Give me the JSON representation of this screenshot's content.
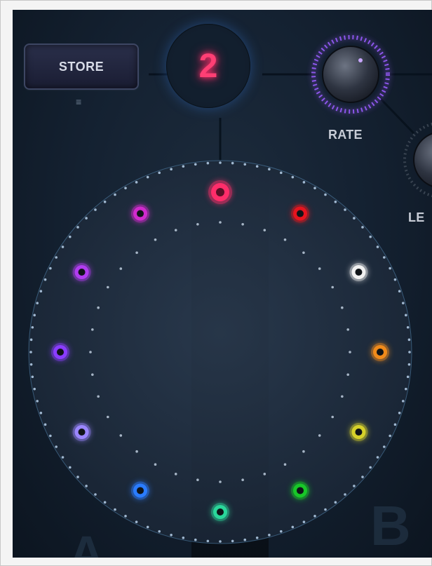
{
  "store": {
    "label": "STORE",
    "menu_icon": "hamburger-menu-icon"
  },
  "preset": {
    "number": "2"
  },
  "knobs": {
    "rate_label": "RATE",
    "level_label_partial": "LE"
  },
  "ghost_letters": {
    "left": "A",
    "right": "B"
  },
  "colors": {
    "accent_pink": "#ff3f74",
    "knob_ring": "#9a5cff",
    "connector": "#3d8cff"
  },
  "wheel": {
    "dots": [
      {
        "name": "dot-top-pink",
        "color": "#ff2d6a",
        "selected": true
      },
      {
        "name": "dot-red",
        "color": "#e6141e"
      },
      {
        "name": "dot-white",
        "color": "#f1f1f1"
      },
      {
        "name": "dot-orange",
        "color": "#f08a1a"
      },
      {
        "name": "dot-yellow",
        "color": "#d6d12a"
      },
      {
        "name": "dot-green",
        "color": "#18c628"
      },
      {
        "name": "dot-teal",
        "color": "#2ad69a"
      },
      {
        "name": "dot-blue",
        "color": "#2a7cff"
      },
      {
        "name": "dot-lavender",
        "color": "#9a86ff"
      },
      {
        "name": "dot-violet",
        "color": "#8a3cff"
      },
      {
        "name": "dot-purple",
        "color": "#b13cf0"
      },
      {
        "name": "dot-magenta",
        "color": "#d02acd"
      }
    ]
  }
}
